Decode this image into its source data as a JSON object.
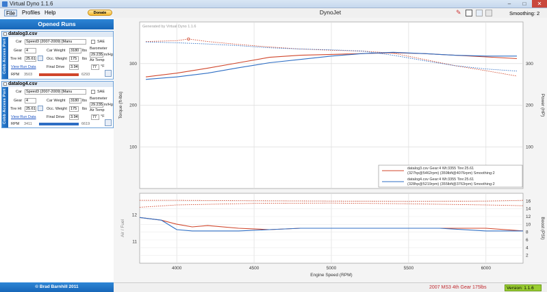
{
  "window": {
    "title": "Virtual Dyno 1.1.6",
    "minimize": "–",
    "maximize": "□",
    "close": "✕"
  },
  "menu": {
    "file": "File",
    "profiles": "Profiles",
    "help": "Help",
    "donate": "Donate"
  },
  "left_panel": {
    "header": "Opened Runs",
    "side_label": "Cobb Access Port",
    "runs": [
      {
        "file": "datalog3.csv",
        "car_label": "Car",
        "car_value": "Speed3  (2007-2009) [Manu",
        "gear_label": "Gear",
        "gear_value": "4",
        "weight_label": "Car Weight",
        "weight_value": "3180",
        "weight_unit": "lbs",
        "tire_label": "Tire Ht",
        "tire_value": "25.61",
        "occ_label": "Occ. Weight",
        "occ_value": "175",
        "occ_unit": "lbs",
        "drive_label": "Final Drive",
        "drive_value": "3.94",
        "sae_label": "SAE",
        "baro_label": "Barometer",
        "baro_value": "29.235",
        "baro_unit": "in/Hg",
        "air_label": "Air Temp",
        "air_value": "77",
        "air_unit": "°F",
        "view_link": "View Run Data",
        "rpm_label": "RPM",
        "rpm_min": "3503",
        "rpm_max": "6293",
        "bar_color": "#d0452a"
      },
      {
        "file": "datalog4.csv",
        "car_label": "Car",
        "car_value": "Speed3  (2007-2009) [Manu",
        "gear_label": "Gear",
        "gear_value": "4",
        "weight_label": "Car Weight",
        "weight_value": "3180",
        "weight_unit": "lbs",
        "tire_label": "Tire Ht",
        "tire_value": "25.61",
        "occ_label": "Occ. Weight",
        "occ_value": "175",
        "occ_unit": "lbs",
        "drive_label": "Final Drive",
        "drive_value": "3.94",
        "sae_label": "SAE",
        "baro_label": "Barometer",
        "baro_value": "29.235",
        "baro_unit": "in/Hg",
        "air_label": "Air Temp",
        "air_value": "77",
        "air_unit": "°F",
        "view_link": "View Run Data",
        "rpm_label": "RPM",
        "rpm_min": "3411",
        "rpm_max": "6619",
        "bar_color": "#2c6dc4"
      }
    ],
    "copyright": "© Brad Barnhill 2011"
  },
  "toolbar": {
    "smoothing": "Smoothing: 2"
  },
  "status": {
    "note": "2007 MS3 4th Gear 175lbs",
    "version": "Version: 1.1.6"
  },
  "chart_data": {
    "type": "line",
    "title": "DynoJet",
    "watermark": "Generated by Virtual Dyno 1.1.6",
    "xlabel": "Engine Speed (RPM)",
    "x_ticks": [
      4000,
      4500,
      5000,
      5500,
      6000
    ],
    "xlim": [
      3760,
      6240
    ],
    "upper": {
      "ylabel_left": "Torque (ft-lbs)",
      "ylabel_right": "Power (HP)",
      "ylim": [
        0,
        400
      ],
      "y_ticks": [
        100,
        200,
        300
      ],
      "series": [
        {
          "name": "datalog3.csv Gear:4 Wt:3355 Tire:25.61",
          "color": "#d0452a",
          "kind": "power",
          "x": [
            3800,
            4000,
            4200,
            4400,
            4600,
            4800,
            5000,
            5200,
            5400,
            5600,
            5800,
            6000,
            6200
          ],
          "y": [
            268,
            277,
            289,
            302,
            315,
            320,
            322,
            324,
            326,
            324,
            320,
            316,
            312
          ]
        },
        {
          "name": "(327hp@5462rpm) (359lbft@4076rpm) Smoothing:2",
          "color": "#d0452a",
          "kind": "torque",
          "x": [
            3800,
            4000,
            4076,
            4200,
            4400,
            4600,
            4800,
            5000,
            5200,
            5400,
            5600,
            5800,
            6000,
            6200
          ],
          "y": [
            353,
            355,
            359,
            353,
            346,
            340,
            335,
            332,
            330,
            325,
            310,
            295,
            283,
            270
          ]
        },
        {
          "name": "datalog4.csv Gear:4 Wt:3355 Tire:25.61",
          "color": "#2c6dc4",
          "kind": "power",
          "x": [
            3800,
            4000,
            4200,
            4400,
            4600,
            4800,
            5000,
            5200,
            5400,
            5600,
            5800,
            6000,
            6200
          ],
          "y": [
            262,
            268,
            277,
            290,
            302,
            310,
            318,
            324,
            327,
            324,
            320,
            318,
            318
          ]
        },
        {
          "name": "(328hp@5219rpm) (355lbft@3763rpm) Smoothing:2",
          "color": "#2c6dc4",
          "kind": "torque",
          "x": [
            3800,
            4000,
            4200,
            4400,
            4600,
            4800,
            5000,
            5200,
            5400,
            5600,
            5800,
            6000,
            6200
          ],
          "y": [
            352,
            350,
            347,
            343,
            338,
            335,
            333,
            330,
            320,
            307,
            295,
            287,
            282
          ]
        }
      ]
    },
    "lower": {
      "ylabel_left": "Air / Fuel",
      "ylabel_right": "Boost (PSI)",
      "afr_ticks": [
        11,
        12
      ],
      "afr_lim": [
        10.2,
        12.8
      ],
      "boost_ticks": [
        2,
        4,
        6,
        8,
        10,
        12,
        14,
        16
      ],
      "boost_lim": [
        0,
        18
      ],
      "series": [
        {
          "name": "datalog3 AFR",
          "color": "#d0452a",
          "x": [
            3760,
            3900,
            4000,
            4100,
            4200,
            4400,
            4600,
            4800,
            5000,
            5200,
            5400,
            5700,
            6000,
            6240
          ],
          "y": [
            11.9,
            11.8,
            11.65,
            11.55,
            11.6,
            11.5,
            11.45,
            11.5,
            11.5,
            11.5,
            11.5,
            11.5,
            11.5,
            11.4
          ]
        },
        {
          "name": "datalog4 AFR",
          "color": "#2c6dc4",
          "x": [
            3760,
            3900,
            4000,
            4100,
            4200,
            4400,
            4600,
            4800,
            5000,
            5200,
            5400,
            5700,
            6000,
            6240
          ],
          "y": [
            11.9,
            11.8,
            11.45,
            11.4,
            11.4,
            11.4,
            11.45,
            11.5,
            11.5,
            11.5,
            11.5,
            11.5,
            11.4,
            11.4
          ]
        },
        {
          "name": "datalog3 boost",
          "color": "#d0452a",
          "x": [
            3760,
            4000,
            4500,
            5000,
            5500,
            6000,
            6240
          ],
          "y": [
            16.2,
            16.2,
            16.1,
            16.0,
            15.9,
            16.0,
            16.2
          ]
        },
        {
          "name": "datalog4 boost",
          "color": "#d0452a",
          "x": [
            3760,
            4000,
            4500,
            5000,
            5500,
            6000,
            6240
          ],
          "y": [
            14.4,
            15.0,
            15.4,
            15.5,
            15.3,
            15.0,
            14.8
          ]
        }
      ]
    },
    "legend": {
      "position": "bottom-right",
      "entries": [
        {
          "label": "datalog3.csv Gear:4 Wt:3355 Tire:25.61",
          "sub": "(327hp@5462rpm) (359lbft@4076rpm) Smoothing:2",
          "color": "#d0452a"
        },
        {
          "label": "datalog4.csv Gear:4 Wt:3355 Tire:25.61",
          "sub": "(328hp@5219rpm) (355lbft@3763rpm) Smoothing:2",
          "color": "#2c6dc4"
        }
      ]
    }
  }
}
